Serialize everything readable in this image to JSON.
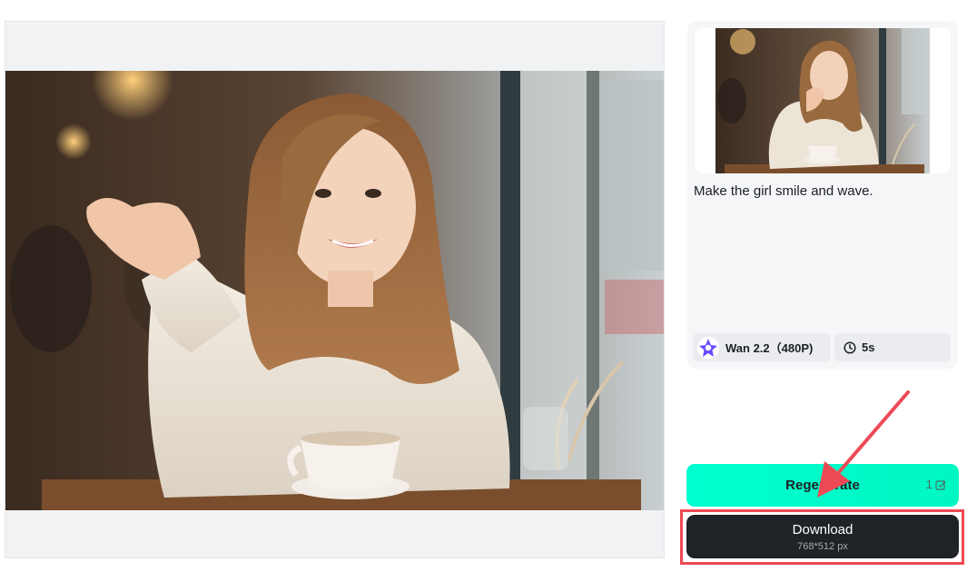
{
  "preview": {
    "image_alt": "Girl in cream sweater waving at a café table"
  },
  "details": {
    "prompt": "Make the girl smile and wave.",
    "model_label": "Wan 2.2（480P)",
    "duration_label": "5s"
  },
  "actions": {
    "regenerate_label": "Regenerate",
    "regenerate_cost": "1",
    "download_label": "Download",
    "download_size": "768*512 px"
  },
  "colors": {
    "accent": "#00ffcc",
    "download_bg": "#1f2226",
    "highlight": "#ee4a55"
  }
}
